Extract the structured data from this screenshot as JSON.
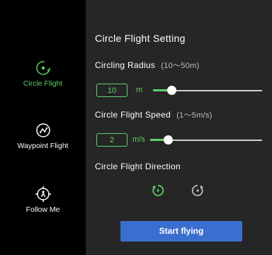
{
  "sidebar": {
    "items": [
      {
        "label": "Circle Flight",
        "icon": "circle-flight-icon",
        "active": true
      },
      {
        "label": "Waypoint Flight",
        "icon": "waypoint-flight-icon",
        "active": false
      },
      {
        "label": "Follow Me",
        "icon": "follow-me-icon",
        "active": false
      }
    ]
  },
  "panel": {
    "title": "Circle Flight Setting",
    "radius": {
      "label": "Circling Radius",
      "range": "(10～50m)",
      "value": "10",
      "unit": "m",
      "level": 0
    },
    "speed": {
      "label": "Circle Flight Speed",
      "range": "(1～5m/s)",
      "value": "2",
      "unit": "m/s",
      "level": 0.25
    },
    "direction": {
      "label": "Circle Flight Direction",
      "options": [
        {
          "icon": "counterclockwise-icon",
          "selected": true
        },
        {
          "icon": "clockwise-icon",
          "selected": false
        }
      ]
    },
    "start_label": "Start flying"
  },
  "colors": {
    "accent": "#5fd168",
    "button": "#3b6fcf",
    "panel": "#262626",
    "sidebar": "#000000"
  }
}
